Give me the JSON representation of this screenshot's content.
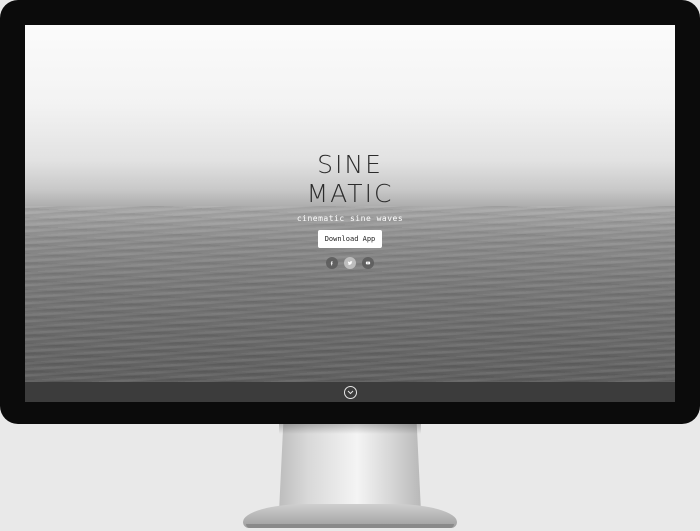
{
  "hero": {
    "title_line1": "SINE",
    "title_line2": "MATIC",
    "tagline": "cinematic sine waves",
    "download_label": "Download App"
  },
  "socials": [
    {
      "name": "facebook-icon",
      "glyph": "f"
    },
    {
      "name": "twitter-icon",
      "glyph": "t"
    },
    {
      "name": "youtube-icon",
      "glyph": "y"
    }
  ],
  "colors": {
    "bezel": "#0b0b0b",
    "bottom_bar": "#3c3c3c",
    "title_text": "#2b2b2b"
  }
}
